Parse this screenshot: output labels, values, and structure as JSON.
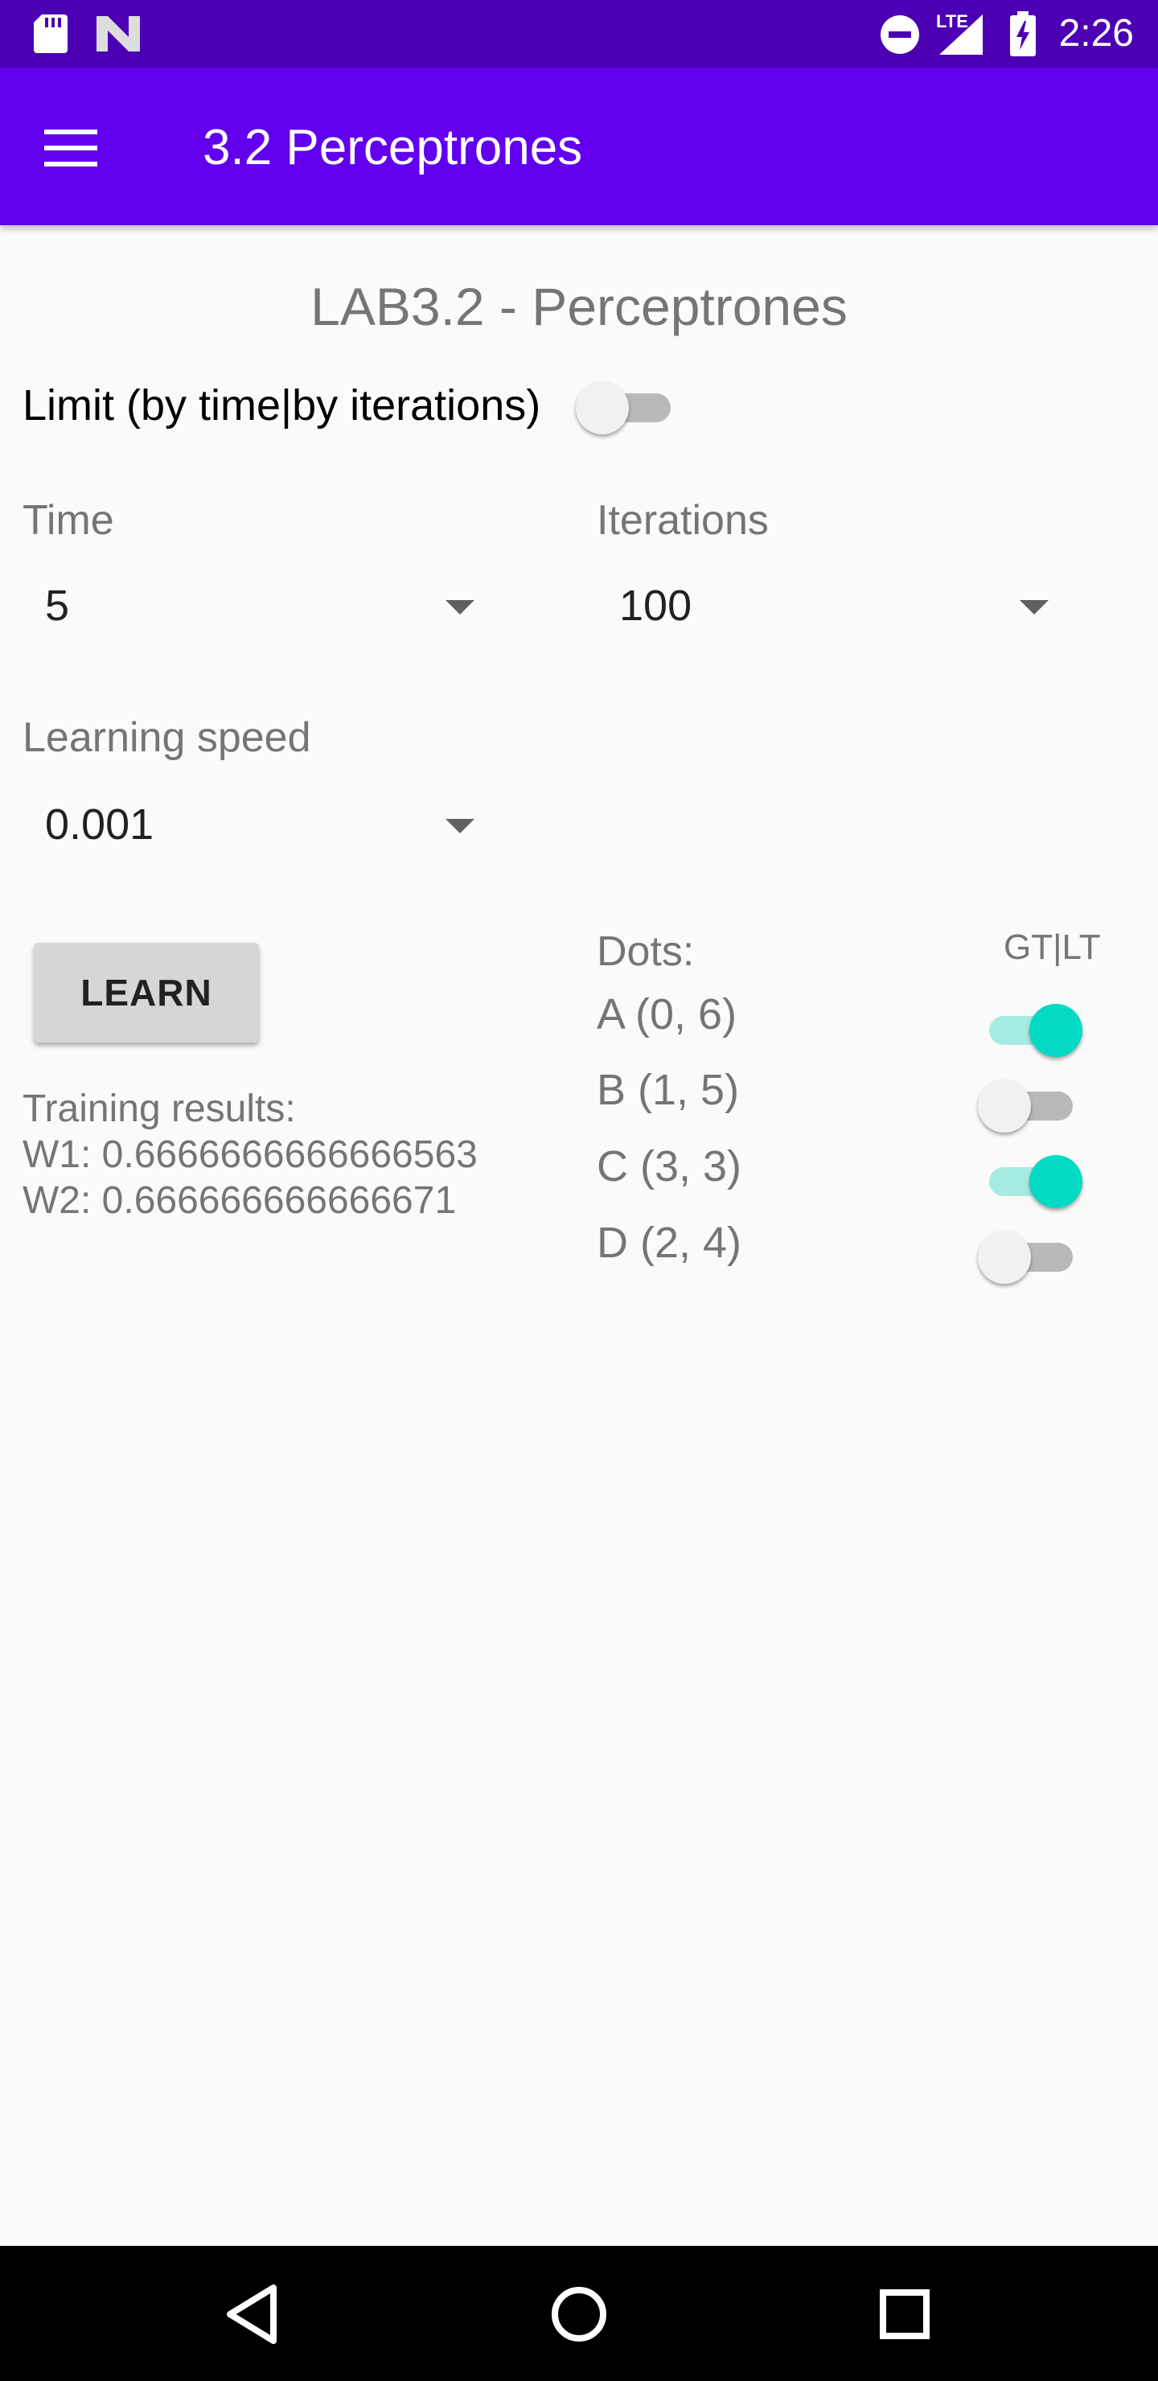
{
  "status_bar": {
    "time": "2:26",
    "left_icons": [
      "sd-card-icon",
      "notification-n-icon"
    ],
    "right_icons": [
      "do-not-disturb-icon",
      "lte-signal-icon",
      "battery-charging-icon"
    ],
    "network_label": "LTE"
  },
  "app_bar": {
    "title": "3.2 Perceptrones",
    "menu_icon": "hamburger-menu-icon",
    "color": "#6200ee"
  },
  "content": {
    "heading": "LAB3.2 - Perceptrones",
    "limit_toggle": {
      "label": "Limit (by time|by iterations)",
      "checked": false
    },
    "time": {
      "label": "Time",
      "selected": "5"
    },
    "iterations": {
      "label": "Iterations",
      "selected": "100"
    },
    "learning_speed": {
      "label": "Learning speed",
      "selected": "0.001"
    },
    "learn_button": "LEARN",
    "results": {
      "title": "Training results:",
      "w1": "W1: 0.6666666666666563",
      "w2": "W2: 0.666666666666671"
    },
    "dots": {
      "header": "Dots:",
      "toggle_header": "GT|LT",
      "items": [
        {
          "label": "A (0, 6)",
          "checked": true
        },
        {
          "label": "B (1, 5)",
          "checked": false
        },
        {
          "label": "C (3, 3)",
          "checked": true
        },
        {
          "label": "D (2, 4)",
          "checked": false
        }
      ]
    },
    "accent_color": "#03dac5"
  },
  "nav_bar": {
    "buttons": [
      "back-icon",
      "home-icon",
      "recents-icon"
    ]
  }
}
